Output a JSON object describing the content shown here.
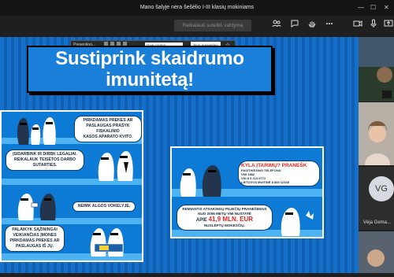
{
  "window": {
    "title": "Mano šalyje nėra šešėlio I-III klasių mokiniams",
    "controls": [
      "—",
      "☐",
      "✕"
    ]
  },
  "toolbar": {
    "request_control_label": "Reikalauti suteikti valdymą",
    "icons": [
      "people-icon",
      "chat-icon",
      "raise-hand-icon",
      "more-icon",
      "camera-icon",
      "mic-icon",
      "share-icon"
    ]
  },
  "presenting_bar": {
    "presenting_label": "Presenting...",
    "give_control_label": "Give control",
    "stop_label": "Stop presenting",
    "pin_icon": "pin-icon"
  },
  "slide": {
    "headline": [
      "Sustiprink skaidrumo",
      "imunitetą!"
    ],
    "left_card": {
      "bubble1": [
        "PIRKDAMAS PREKES AR",
        "PASLAUGAS PRAŠYK FISKALINIO",
        "KASOS APARATO KVITO."
      ],
      "bubble2": [
        "ĮSIDARBINK IR DIRBK LEGALIAI.",
        "REIKALAUK TEISĖTOS DARBO",
        "SUTARTIES."
      ],
      "bubble3": [
        "NEIMK ALGOS VOKELYJE."
      ],
      "bubble4": [
        "PALAIKYK SĄŽININGAI",
        "VEIKIANČIAS ĮMONES",
        "PIRKDAMAS PREKES AR",
        "PASLAUGAS IŠ JŲ."
      ]
    },
    "right_card": {
      "report_title": "KYLA ĮTARIMŲ? PRANEŠK",
      "report_lines": [
        "PASITIKĖJIMO TELEFONU",
        "VMI 1882",
        "VDI 8 5 213 9772",
        "LIETUVOS MUITINĖ 8 800 12345"
      ],
      "reward_lines": [
        "REMIANTIS ATSAKINGŲ PILIEČIŲ PRANEŠIMAIS",
        "NUO 2006 METŲ VMI NUSTATĖ"
      ],
      "reward_pre": "APIE",
      "reward_amount": "41,9 MLN. EUR",
      "reward_post": "NUSLĖPTŲ MOKESČIŲ."
    }
  },
  "participants": [
    {
      "initials": "VG",
      "name": "Vėja Gema..."
    }
  ],
  "colors": {
    "slide_blue": "#1670c9",
    "slide_stripe": "#0f5fb3",
    "accent_red": "#e0261d",
    "toolbar": "#1f1f1f"
  }
}
